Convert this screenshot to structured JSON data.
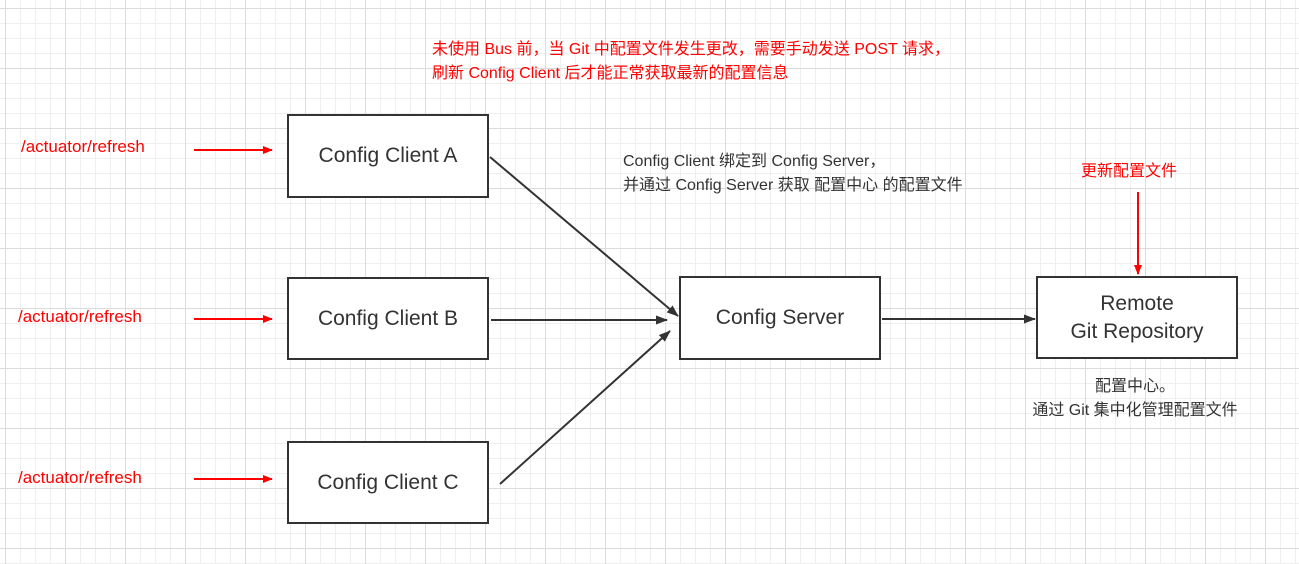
{
  "diagram": {
    "title_note": "未使用 Bus 前，当 Git 中配置文件发生更改，需要手动发送 POST 请求，\n刷新 Config Client 后才能正常获取最新的配置信息",
    "nodes": {
      "client_a": "Config Client A",
      "client_b": "Config Client B",
      "client_c": "Config Client C",
      "server": "Config Server",
      "repo": "Remote\nGit Repository"
    },
    "refresh_labels": {
      "a": "/actuator/refresh",
      "b": "/actuator/refresh",
      "c": "/actuator/refresh"
    },
    "binding_note": "Config Client 绑定到 Config Server，\n并通过 Config Server 获取 配置中心 的配置文件",
    "update_note": "更新配置文件",
    "repo_note": "配置中心。\n通过 Git 集中化管理配置文件",
    "edges": [
      {
        "from": "refresh-a",
        "to": "Config Client A",
        "style": "red"
      },
      {
        "from": "refresh-b",
        "to": "Config Client B",
        "style": "red"
      },
      {
        "from": "refresh-c",
        "to": "Config Client C",
        "style": "red"
      },
      {
        "from": "Config Client A",
        "to": "Config Server",
        "style": "dark"
      },
      {
        "from": "Config Client B",
        "to": "Config Server",
        "style": "dark"
      },
      {
        "from": "Config Client C",
        "to": "Config Server",
        "style": "dark"
      },
      {
        "from": "Config Server",
        "to": "Remote Git Repository",
        "style": "dark"
      },
      {
        "from": "更新配置文件",
        "to": "Remote Git Repository",
        "style": "red"
      }
    ],
    "colors": {
      "highlight": "#ff0000",
      "stroke": "#333333",
      "grid_major": "#dcdcdc",
      "grid_minor": "#efefef"
    }
  }
}
